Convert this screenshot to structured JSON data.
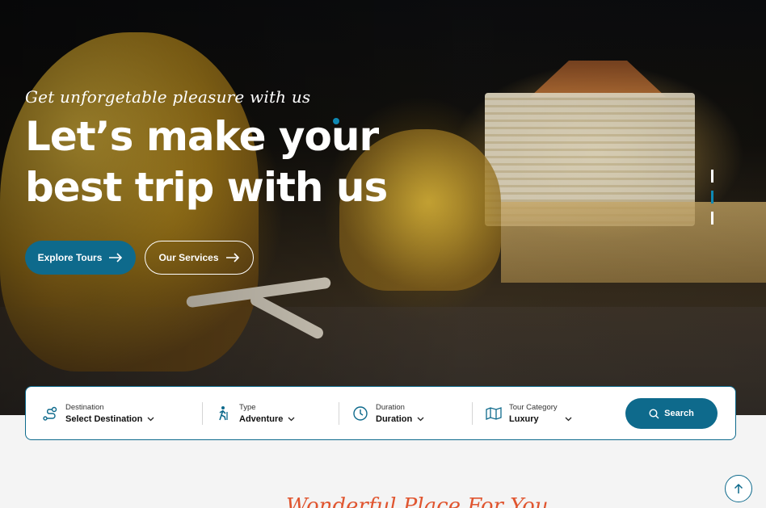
{
  "hero": {
    "tagline": "Get unforgetable pleasure with us",
    "headline_line1": "Let’s make your",
    "headline_line2": "best trip with us",
    "buttons": {
      "explore_label": "Explore Tours",
      "services_label": "Our Services"
    },
    "slider": {
      "count": 3,
      "active_index": 1
    }
  },
  "search": {
    "fields": [
      {
        "label": "Destination",
        "value": "Select Destination",
        "icon": "route-icon"
      },
      {
        "label": "Type",
        "value": "Adventure",
        "icon": "hiker-icon"
      },
      {
        "label": "Duration",
        "value": "Duration",
        "icon": "clock-icon"
      },
      {
        "label": "Tour Category",
        "value": "Luxury",
        "icon": "map-icon"
      }
    ],
    "button_label": "Search"
  },
  "section": {
    "partial_title": "Wonderful Place For You"
  },
  "colors": {
    "accent": "#0e6a8c",
    "accent_light": "#0e88b3",
    "script_title": "#e0552f"
  }
}
